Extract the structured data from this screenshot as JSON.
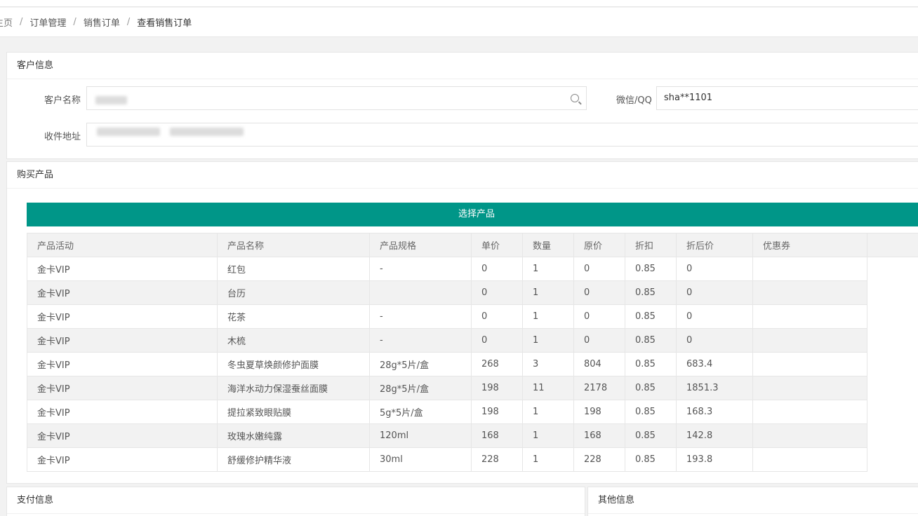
{
  "breadcrumb": {
    "home": "主页",
    "level1": "订单管理",
    "level2": "销售订单",
    "current": "查看销售订单",
    "separator": "/"
  },
  "customer": {
    "title": "客户信息",
    "name_label": "客户名称",
    "wechat_label": "微信/QQ",
    "wechat_value": "sha**1101",
    "address_label": "收件地址"
  },
  "products": {
    "title": "购买产品",
    "select_button": "选择产品",
    "columns": [
      "产品活动",
      "产品名称",
      "产品规格",
      "单价",
      "数量",
      "原价",
      "折扣",
      "折后价",
      "优惠券"
    ],
    "rows": [
      [
        "金卡VIP",
        "红包",
        "-",
        "0",
        "1",
        "0",
        "0.85",
        "0",
        ""
      ],
      [
        "金卡VIP",
        "台历",
        "",
        "0",
        "1",
        "0",
        "0.85",
        "0",
        ""
      ],
      [
        "金卡VIP",
        "花茶",
        "-",
        "0",
        "1",
        "0",
        "0.85",
        "0",
        ""
      ],
      [
        "金卡VIP",
        "木梳",
        "-",
        "0",
        "1",
        "0",
        "0.85",
        "0",
        ""
      ],
      [
        "金卡VIP",
        "冬虫夏草焕颜修护面膜",
        "28g*5片/盒",
        "268",
        "3",
        "804",
        "0.85",
        "683.4",
        ""
      ],
      [
        "金卡VIP",
        "海洋水动力保湿蚕丝面膜",
        "28g*5片/盒",
        "198",
        "11",
        "2178",
        "0.85",
        "1851.3",
        ""
      ],
      [
        "金卡VIP",
        "提拉紧致眼贴膜",
        "5g*5片/盒",
        "198",
        "1",
        "198",
        "0.85",
        "168.3",
        ""
      ],
      [
        "金卡VIP",
        "玫瑰水嫩纯露",
        "120ml",
        "168",
        "1",
        "168",
        "0.85",
        "142.8",
        ""
      ],
      [
        "金卡VIP",
        "舒缓修护精华液",
        "30ml",
        "228",
        "1",
        "228",
        "0.85",
        "193.8",
        ""
      ]
    ]
  },
  "payment": {
    "title": "支付信息"
  },
  "other": {
    "title": "其他信息"
  },
  "colors": {
    "accent": "#009688",
    "stripe": "#f2f2f2",
    "border": "#e6e6e6"
  }
}
